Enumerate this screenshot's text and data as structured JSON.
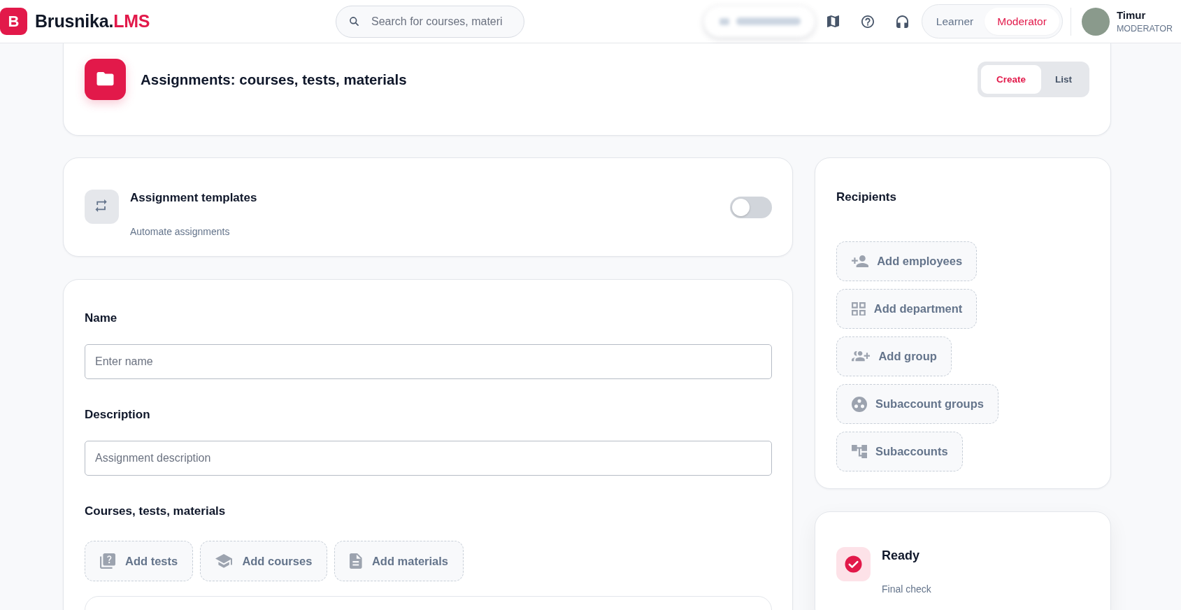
{
  "header": {
    "logo": {
      "letter": "B",
      "text": "Brusnika.",
      "accent": "LMS"
    },
    "search": {
      "placeholder": "Search for courses, materi"
    },
    "roles": [
      {
        "label": "Learner",
        "selected": false
      },
      {
        "label": "Moderator",
        "selected": true
      }
    ],
    "user": {
      "name": "Timur",
      "role": "MODERATOR"
    }
  },
  "page_header": {
    "title": "Assignments: courses, tests, materials",
    "tabs": [
      {
        "label": "Create",
        "selected": true
      },
      {
        "label": "List",
        "selected": false
      }
    ]
  },
  "templates": {
    "title": "Assignment templates",
    "subtitle": "Automate assignments",
    "on": false
  },
  "form": {
    "fields": [
      {
        "label": "Name",
        "placeholder": "Enter name"
      },
      {
        "label": "Description",
        "placeholder": "Assignment description"
      }
    ],
    "content_section": {
      "title": "Courses, tests, materials",
      "buttons": [
        {
          "kind": "tests",
          "label": "Add tests"
        },
        {
          "kind": "courses",
          "label": "Add courses"
        },
        {
          "kind": "materials",
          "label": "Add materials"
        }
      ]
    }
  },
  "recipients": {
    "title": "Recipients",
    "buttons": [
      {
        "kind": "employees",
        "label": "Add employees"
      },
      {
        "kind": "department",
        "label": "Add department"
      },
      {
        "kind": "group",
        "label": "Add group"
      },
      {
        "kind": "subaccount_groups",
        "label": "Subaccount groups"
      },
      {
        "kind": "subaccounts",
        "label": "Subaccounts"
      }
    ]
  },
  "status": {
    "title": "Ready",
    "subtitle": "Final check"
  }
}
